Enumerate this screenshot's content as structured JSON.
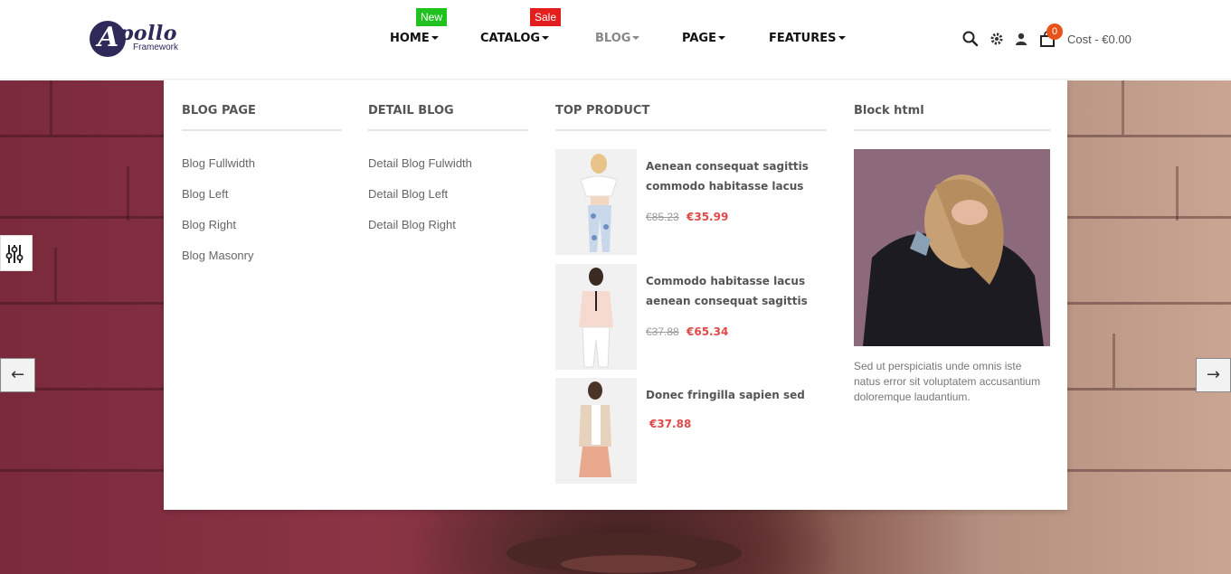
{
  "header": {
    "logo": {
      "word": "pollo",
      "letter": "A",
      "sub": "Framework"
    },
    "nav": [
      {
        "label": "HOME",
        "badge": "New",
        "badge_color": "#1fc21f"
      },
      {
        "label": "CATALOG",
        "badge": "Sale",
        "badge_color": "#e31e1e"
      },
      {
        "label": "BLOG",
        "active": true
      },
      {
        "label": "PAGE"
      },
      {
        "label": "FEATURES"
      }
    ],
    "tools": {
      "search_icon": "search-icon",
      "settings_icon": "gear-icon",
      "user_icon": "user-icon",
      "cart_icon": "shopping-bag-icon",
      "cart_count": "0",
      "cost_label": "Cost -  €0.00"
    }
  },
  "mega_menu": {
    "blog_page": {
      "title": "BLOG PAGE",
      "links": [
        "Blog Fullwidth",
        "Blog Left",
        "Blog Right",
        "Blog Masonry"
      ]
    },
    "detail_blog": {
      "title": "DETAIL BLOG",
      "links": [
        "Detail Blog Fulwidth",
        "Detail Blog Left",
        "Detail Blog Right"
      ]
    },
    "top_product": {
      "title": "TOP PRODUCT",
      "products": [
        {
          "name": "Aenean consequat sagittis commodo habitasse lacus",
          "old_price": "€85.23",
          "price": "€35.99"
        },
        {
          "name": "Commodo habitasse lacus aenean consequat sagittis",
          "old_price": "€37.88",
          "price": "€65.34"
        },
        {
          "name": "Donec fringilla sapien sed",
          "old_price": "",
          "price": "€37.88"
        }
      ]
    },
    "block_html": {
      "title": "Block html",
      "text": "Sed ut perspiciatis unde omnis iste natus error sit voluptatem accusantium doloremque laudantium."
    }
  },
  "slider": {
    "prev_label": "←",
    "next_label": "→"
  },
  "colors": {
    "brand": "#2d2a5a",
    "price": "#e04a4a",
    "cart_badge": "#e8531a"
  }
}
